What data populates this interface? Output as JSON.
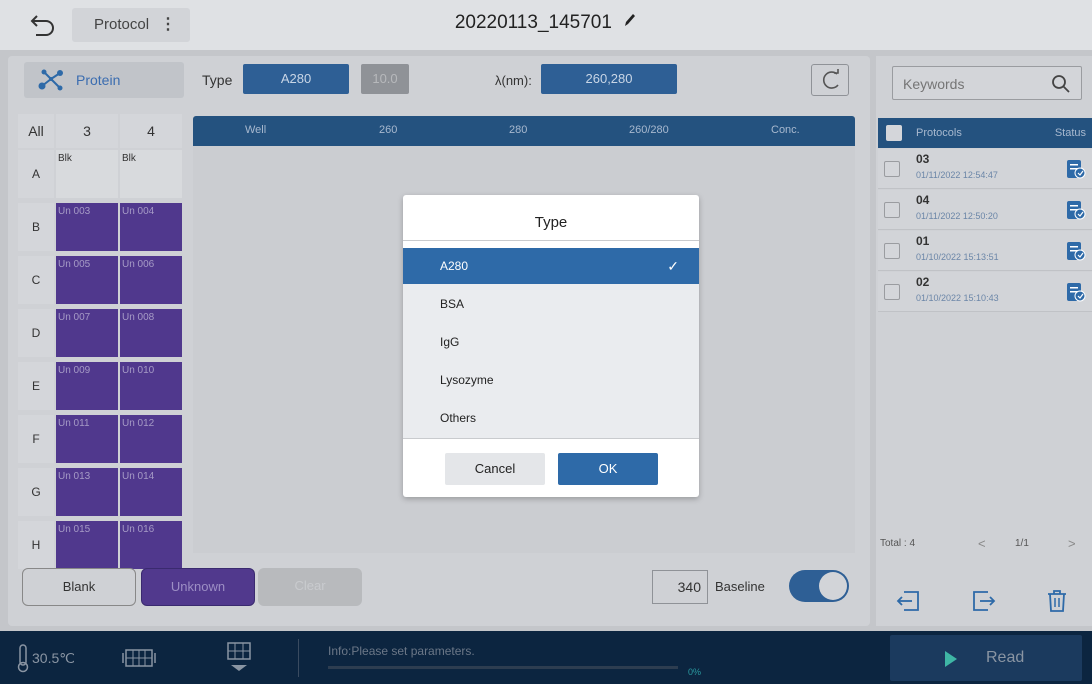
{
  "header": {
    "back_icon": "back-arrow-icon",
    "protocol_label": "Protocol",
    "protocol_menu_icon": "kebab-menu-icon",
    "title": "20220113_145701",
    "edit_icon": "pencil-icon"
  },
  "toolbar": {
    "mode_icon": "molecule-icon",
    "mode_label": "Protein",
    "type_label": "Type",
    "type_value": "A280",
    "type_factor": "10.0",
    "lambda_label": "λ(nm):",
    "lambda_value": "260,280",
    "refresh_icon": "refresh-icon"
  },
  "plate": {
    "all_label": "All",
    "columns": [
      "3",
      "4"
    ],
    "rows": [
      {
        "label": "A",
        "cells": [
          "Blk",
          "Blk"
        ],
        "kind": "blank"
      },
      {
        "label": "B",
        "cells": [
          "Un 003",
          "Un 004"
        ],
        "kind": "unknown"
      },
      {
        "label": "C",
        "cells": [
          "Un 005",
          "Un 006"
        ],
        "kind": "unknown"
      },
      {
        "label": "D",
        "cells": [
          "Un 007",
          "Un 008"
        ],
        "kind": "unknown"
      },
      {
        "label": "E",
        "cells": [
          "Un 009",
          "Un 010"
        ],
        "kind": "unknown"
      },
      {
        "label": "F",
        "cells": [
          "Un 011",
          "Un 012"
        ],
        "kind": "unknown"
      },
      {
        "label": "G",
        "cells": [
          "Un 013",
          "Un 014"
        ],
        "kind": "unknown"
      },
      {
        "label": "H",
        "cells": [
          "Un 015",
          "Un 016"
        ],
        "kind": "unknown"
      }
    ]
  },
  "results_table": {
    "columns": [
      "Well",
      "260",
      "280",
      "260/280",
      "Conc."
    ]
  },
  "bottom_controls": {
    "blank_label": "Blank",
    "unknown_label": "Unknown",
    "clear_label": "Clear",
    "wavelength_value": "340",
    "baseline_label": "Baseline",
    "baseline_on": true
  },
  "side": {
    "search_placeholder": "Keywords",
    "search_icon": "search-icon",
    "list_header": "Protocols",
    "status_header": "Status",
    "items": [
      {
        "name": "03",
        "date": "01/11/2022 12:54:47"
      },
      {
        "name": "04",
        "date": "01/11/2022 12:50:20"
      },
      {
        "name": "01",
        "date": "01/10/2022 15:13:51"
      },
      {
        "name": "02",
        "date": "01/10/2022 15:10:43"
      }
    ],
    "total": "Total : 4",
    "page": "1/1",
    "prev": "<",
    "next": ">",
    "import_icon": "import-icon",
    "export_icon": "export-icon",
    "delete_icon": "trash-icon"
  },
  "status": {
    "thermometer_icon": "thermometer-icon",
    "temperature": "30.5℃",
    "plate_icon": "plate-icon",
    "plate_eject_icon": "plate-eject-icon",
    "info": "Info:Please set parameters.",
    "progress_fraction": 0,
    "progress_text": "0%",
    "read_label": "Read",
    "read_icon": "play-icon"
  },
  "dialog": {
    "title": "Type",
    "options": [
      "A280",
      "BSA",
      "IgG",
      "Lysozyme",
      "Others"
    ],
    "selected": "A280",
    "check_icon": "checkmark-icon",
    "cancel_label": "Cancel",
    "ok_label": "OK"
  },
  "colors": {
    "accent": "#2e5f95",
    "unknown_well": "#50388d",
    "status_bar": "#0c2540",
    "dialog_selected": "#2e6aa8"
  }
}
